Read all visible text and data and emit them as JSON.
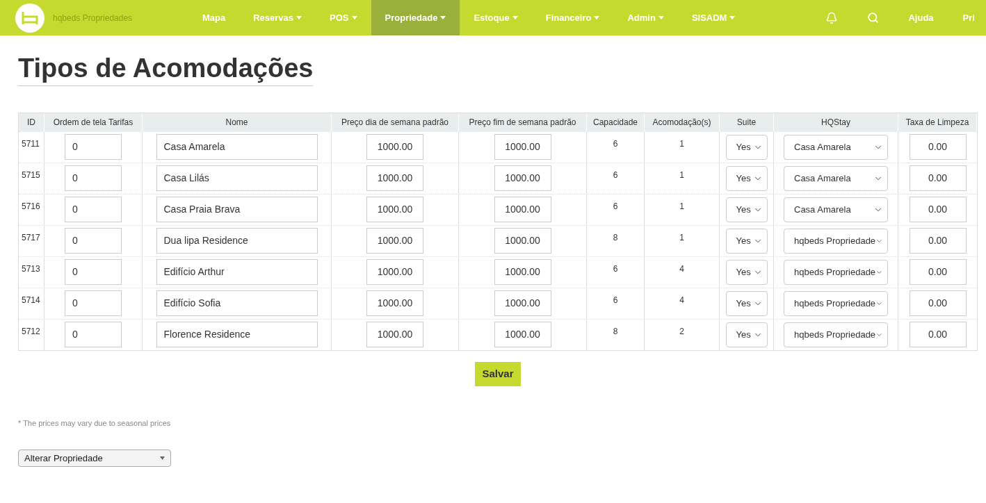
{
  "brand": {
    "name": "hqbeds Propriedades"
  },
  "nav": [
    {
      "label": "Mapa",
      "dropdown": false,
      "selected": false
    },
    {
      "label": "Reservas",
      "dropdown": true,
      "selected": false
    },
    {
      "label": "POS",
      "dropdown": true,
      "selected": false
    },
    {
      "label": "Propriedade",
      "dropdown": true,
      "selected": true
    },
    {
      "label": "Estoque",
      "dropdown": true,
      "selected": false
    },
    {
      "label": "Financeiro",
      "dropdown": true,
      "selected": false
    },
    {
      "label": "Admin",
      "dropdown": true,
      "selected": false
    },
    {
      "label": "SISADM",
      "dropdown": true,
      "selected": false
    }
  ],
  "nav_right": {
    "help": "Ajuda",
    "user": "Pri"
  },
  "title": "Tipos de Acomodações",
  "table": {
    "columns": [
      "ID",
      "Ordem de tela Tarifas",
      "Nome",
      "Preço dia de semana padrão",
      "Preço fim de semana padrão",
      "Capacidade",
      "Acomodação(s)",
      "Suite",
      "HQStay",
      "Taxa de Limpeza"
    ],
    "rows": [
      {
        "id": "5711",
        "order": "0",
        "name": "Casa Amarela",
        "weekday": "1000.00",
        "weekend": "1000.00",
        "capacity": "6",
        "units": "1",
        "suite": "Yes",
        "hqstay": "Casa Amarela",
        "cleaning": "0.00"
      },
      {
        "id": "5715",
        "order": "0",
        "name": "Casa Lilás",
        "weekday": "1000.00",
        "weekend": "1000.00",
        "capacity": "6",
        "units": "1",
        "suite": "Yes",
        "hqstay": "Casa Amarela",
        "cleaning": "0.00"
      },
      {
        "id": "5716",
        "order": "0",
        "name": "Casa Praia Brava",
        "weekday": "1000.00",
        "weekend": "1000.00",
        "capacity": "6",
        "units": "1",
        "suite": "Yes",
        "hqstay": "Casa Amarela",
        "cleaning": "0.00"
      },
      {
        "id": "5717",
        "order": "0",
        "name": "Dua lipa Residence",
        "weekday": "1000.00",
        "weekend": "1000.00",
        "capacity": "8",
        "units": "1",
        "suite": "Yes",
        "hqstay": "hqbeds Propriedade",
        "cleaning": "0.00"
      },
      {
        "id": "5713",
        "order": "0",
        "name": "Edifício Arthur",
        "weekday": "1000.00",
        "weekend": "1000.00",
        "capacity": "6",
        "units": "4",
        "suite": "Yes",
        "hqstay": "hqbeds Propriedade",
        "cleaning": "0.00"
      },
      {
        "id": "5714",
        "order": "0",
        "name": "Edifício Sofia",
        "weekday": "1000.00",
        "weekend": "1000.00",
        "capacity": "6",
        "units": "4",
        "suite": "Yes",
        "hqstay": "hqbeds Propriedade",
        "cleaning": "0.00"
      },
      {
        "id": "5712",
        "order": "0",
        "name": "Florence Residence",
        "weekday": "1000.00",
        "weekend": "1000.00",
        "capacity": "8",
        "units": "2",
        "suite": "Yes",
        "hqstay": "hqbeds Propriedade",
        "cleaning": "0.00"
      }
    ]
  },
  "save_button": "Salvar",
  "note": "* The prices may vary due to seasonal prices",
  "property_select": "Alterar Propriedade"
}
